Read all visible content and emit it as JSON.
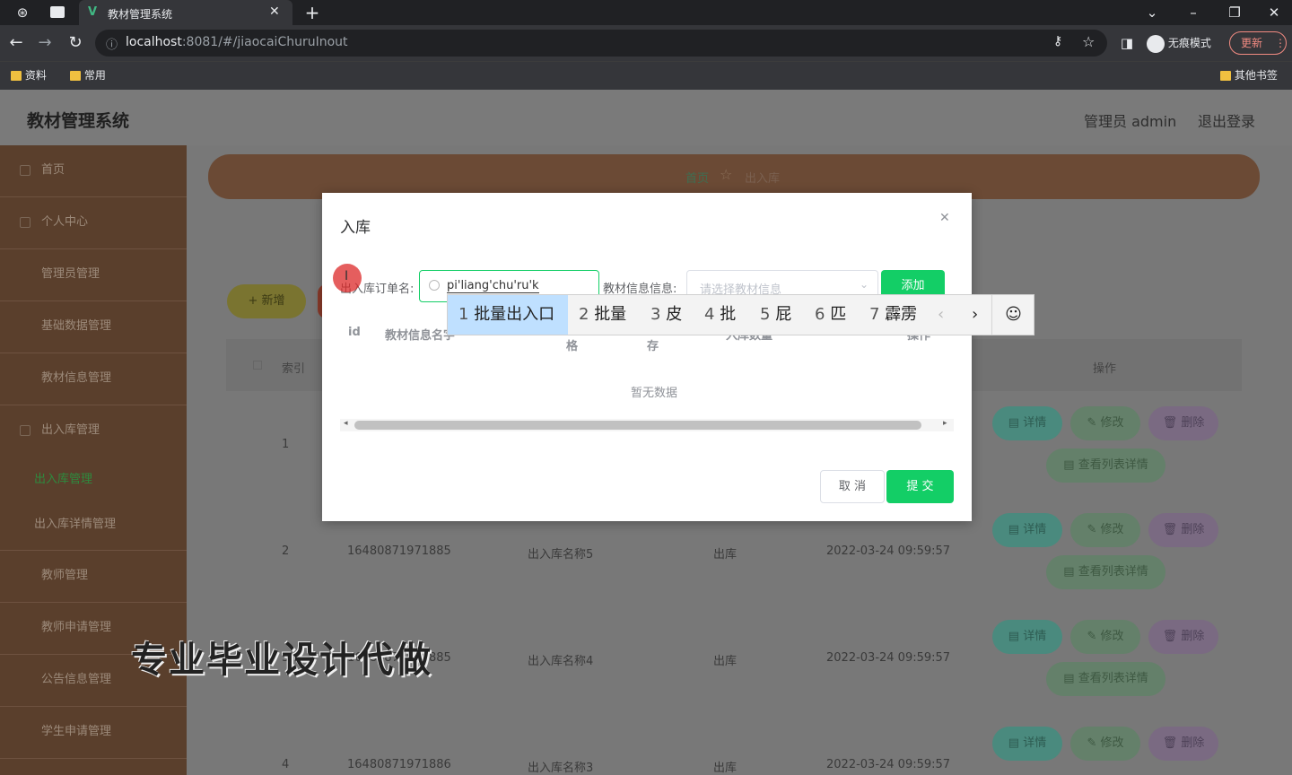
{
  "browser": {
    "tab_title": "教材管理系统",
    "url_host": "localhost",
    "url_rest": ":8081/#/jiaocaiChuruInout",
    "incognito_label": "无痕模式",
    "update_label": "更新",
    "bookmarks": [
      "资料",
      "常用"
    ],
    "other_bookmarks": "其他书签"
  },
  "app": {
    "title": "教材管理系统",
    "user_label": "管理员 admin",
    "logout": "退出登录"
  },
  "sidebar": {
    "items": [
      {
        "label": "首页"
      },
      {
        "label": "个人中心"
      },
      {
        "label": "管理员管理"
      },
      {
        "label": "基础数据管理"
      },
      {
        "label": "教材信息管理"
      },
      {
        "label": "出入库管理"
      }
    ],
    "subitems": [
      {
        "label": "出入库管理"
      },
      {
        "label": "出入库详情管理"
      }
    ],
    "items2": [
      {
        "label": "教师管理"
      },
      {
        "label": "教师申请管理"
      },
      {
        "label": "公告信息管理"
      },
      {
        "label": "学生申请管理"
      }
    ]
  },
  "breadcrumb": {
    "home": "首页",
    "current": "出入库"
  },
  "toolbar": {
    "add_label": "新增"
  },
  "table": {
    "headers": {
      "index": "索引",
      "ops": "操作"
    },
    "rows": [
      {
        "index": "1",
        "id": "",
        "name": "",
        "type": "",
        "time": ""
      },
      {
        "index": "2",
        "id": "16480871971885",
        "name": "出入库名称5",
        "type": "出库",
        "time": "2022-03-24 09:59:57"
      },
      {
        "index": "3",
        "id": "16480871971885",
        "name": "出入库名称4",
        "type": "出库",
        "time": "2022-03-24 09:59:57"
      },
      {
        "index": "4",
        "id": "16480871971886",
        "name": "出入库名称3",
        "type": "出库",
        "time": "2022-03-24 09:59:57"
      }
    ],
    "btn_detail": "详情",
    "btn_edit": "修改",
    "btn_delete": "删除",
    "btn_list": "查看列表详情"
  },
  "dialog": {
    "title": "入库",
    "order_label": "出入库订单名:",
    "order_value": "pi'liang'chu'ru'k",
    "info_label": "教材信息信息:",
    "info_placeholder": "请选择教材信息",
    "add_btn": "添加",
    "col_id": "id",
    "col_name": "教材信息名字",
    "col_spec": "格",
    "col_stock": "存",
    "col_qty": "入库数量",
    "col_op": "操作",
    "empty": "暂无数据",
    "cancel": "取 消",
    "submit": "提 交"
  },
  "ime": {
    "candidates": [
      {
        "n": "1",
        "t": "批量出入口"
      },
      {
        "n": "2",
        "t": "批量"
      },
      {
        "n": "3",
        "t": "皮"
      },
      {
        "n": "4",
        "t": "批"
      },
      {
        "n": "5",
        "t": "屁"
      },
      {
        "n": "6",
        "t": "匹"
      },
      {
        "n": "7",
        "t": "霹雳"
      }
    ]
  },
  "watermark": "专业毕业设计代做",
  "colors": {
    "sidebar": "#5a3f2c",
    "accent": "#13ce66",
    "overlay": "#777777"
  }
}
